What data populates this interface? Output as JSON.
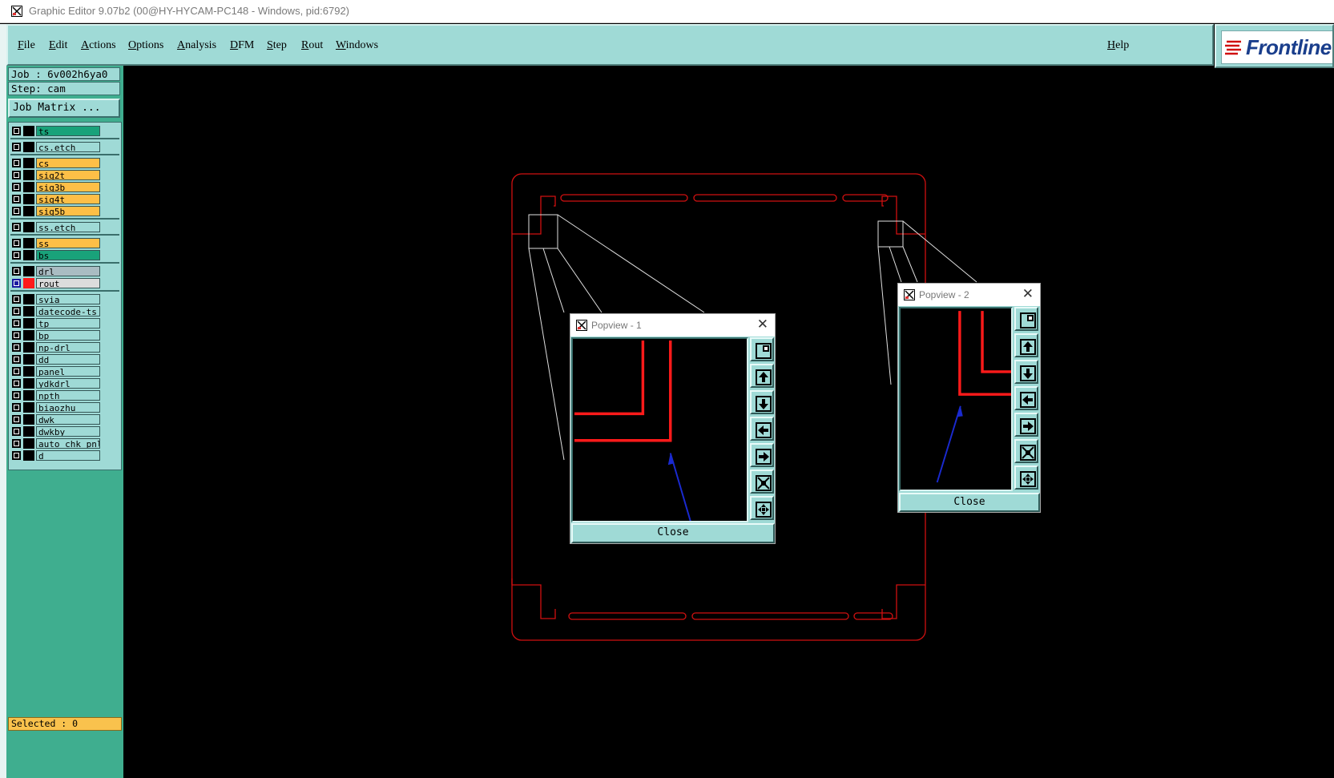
{
  "window": {
    "title": "Graphic Editor 9.07b2 (00@HY-HYCAM-PC148 - Windows, pid:6792)"
  },
  "menu": {
    "file": "File",
    "edit": "Edit",
    "actions": "Actions",
    "options": "Options",
    "analysis": "Analysis",
    "dfm": "DFM",
    "step": "Step",
    "rout": "Rout",
    "windows": "Windows",
    "help": "Help"
  },
  "logo": {
    "text": "Frontline"
  },
  "job": {
    "job_label": "Job : 6v002h6ya0",
    "step_label": "Step: cam",
    "matrix_button": "Job Matrix ..."
  },
  "colors": {
    "panel": "#9fdad6",
    "green_layer": "#19a27a",
    "yellow_layer": "#fdbf47",
    "grey_layer": "#a9bcc2",
    "rout_color": "#ff1a1a",
    "outline": "#d01010"
  },
  "layers": [
    {
      "name": "ts",
      "color": "#19a27a"
    },
    {
      "name": "cs.etch",
      "color": "#9fdad6"
    },
    {
      "name": "cs",
      "color": "#fdbf47"
    },
    {
      "name": "sig2t",
      "color": "#fdbf47"
    },
    {
      "name": "sig3b",
      "color": "#fdbf47"
    },
    {
      "name": "sig4t",
      "color": "#fdbf47"
    },
    {
      "name": "sig5b",
      "color": "#fdbf47"
    },
    {
      "name": "ss.etch",
      "color": "#9fdad6"
    },
    {
      "name": "ss",
      "color": "#fdbf47"
    },
    {
      "name": "bs",
      "color": "#19a27a"
    },
    {
      "name": "drl",
      "color": "#a9bcc2"
    },
    {
      "name": "rout",
      "color": "#dcdcdc",
      "active": true
    },
    {
      "name": "svia",
      "color": "#9fdad6"
    },
    {
      "name": "datecode-ts",
      "color": "#9fdad6"
    },
    {
      "name": "tp",
      "color": "#9fdad6"
    },
    {
      "name": "bp",
      "color": "#9fdad6"
    },
    {
      "name": "np-drl",
      "color": "#9fdad6"
    },
    {
      "name": "dd",
      "color": "#9fdad6"
    },
    {
      "name": "panel",
      "color": "#9fdad6"
    },
    {
      "name": "ydkdrl",
      "color": "#9fdad6"
    },
    {
      "name": "npth",
      "color": "#9fdad6"
    },
    {
      "name": "biaozhu",
      "color": "#9fdad6"
    },
    {
      "name": "dwk",
      "color": "#9fdad6"
    },
    {
      "name": "dwkby",
      "color": "#9fdad6"
    },
    {
      "name": "auto_chk_pnl",
      "color": "#9fdad6"
    },
    {
      "name": "d",
      "color": "#9fdad6"
    }
  ],
  "status": {
    "selected": "Selected : 0"
  },
  "popview1": {
    "title": "Popview - 1",
    "close": "Close"
  },
  "popview2": {
    "title": "Popview - 2",
    "close": "Close"
  },
  "icons": [
    "zoom-window-icon",
    "pan-up-icon",
    "pan-down-icon",
    "pan-left-icon",
    "pan-right-icon",
    "zoom-fit-icon",
    "zoom-home-icon"
  ]
}
